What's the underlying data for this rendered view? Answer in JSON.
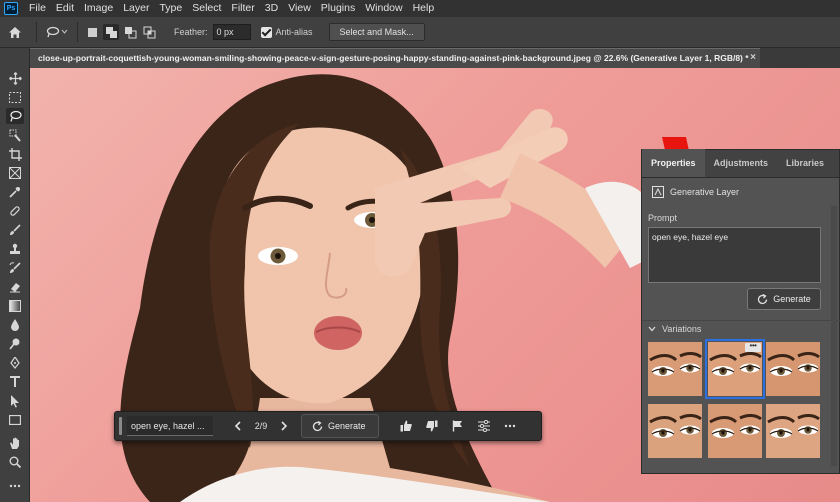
{
  "app": {
    "logo": "Ps",
    "menu": [
      "File",
      "Edit",
      "Image",
      "Layer",
      "Type",
      "Select",
      "Filter",
      "3D",
      "View",
      "Plugins",
      "Window",
      "Help"
    ]
  },
  "options_bar": {
    "feather_label": "Feather:",
    "feather_value": "0 px",
    "antialias_label": "Anti-alias",
    "antialias_checked": true,
    "select_mask_label": "Select and Mask..."
  },
  "document": {
    "tab_title": "close-up-portrait-coquettish-young-woman-smiling-showing-peace-v-sign-gesture-posing-happy-standing-against-pink-background.jpeg @ 22.6% (Generative Layer 1, RGB/8) *",
    "close_glyph": "×"
  },
  "toolbar": {
    "tools": [
      "move-icon",
      "marquee-icon",
      "lasso-icon",
      "quick-select-icon",
      "crop-icon",
      "frame-icon",
      "eyedropper-icon",
      "healing-brush-icon",
      "brush-icon",
      "stamp-icon",
      "history-brush-icon",
      "eraser-icon",
      "gradient-icon",
      "blur-icon",
      "dodge-icon",
      "pen-icon",
      "type-icon",
      "path-select-icon",
      "rectangle-icon",
      "hand-icon",
      "zoom-icon"
    ],
    "active_tool": "lasso-icon"
  },
  "taskbar": {
    "prompt_text": "open eye, hazel ...",
    "counter": "2/9",
    "generate_label": "Generate"
  },
  "panel": {
    "tabs": [
      "Properties",
      "Adjustments",
      "Libraries"
    ],
    "active_tab": "Properties",
    "layer_title": "Generative Layer",
    "prompt_label": "Prompt",
    "prompt_value": "open eye, hazel eye",
    "generate_label": "Generate",
    "variations_label": "Variations",
    "variations_count": 6,
    "selected_variation": 2,
    "more_glyph": "•••"
  },
  "colors": {
    "accent": "#2b6fe0",
    "annotation_arrow": "#e8150f",
    "canvas_bg": "#ef9c98"
  }
}
